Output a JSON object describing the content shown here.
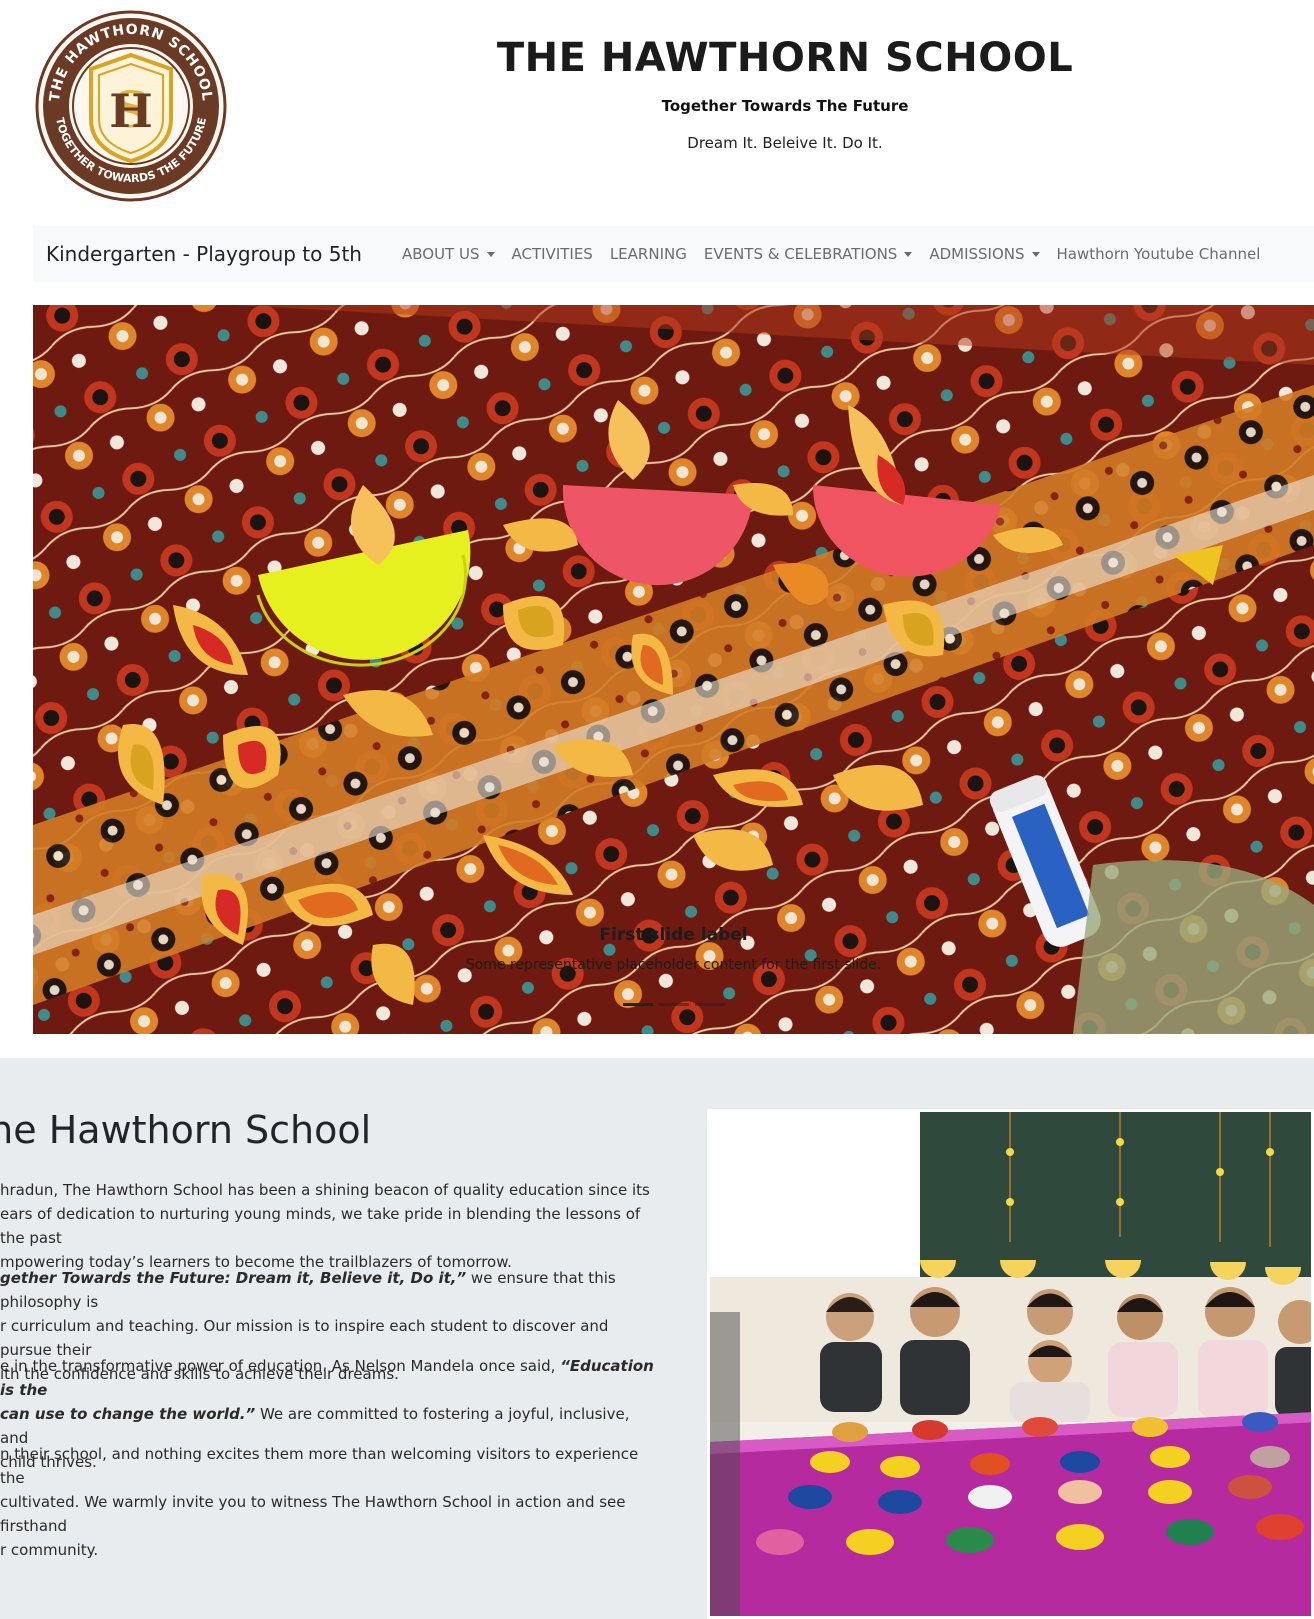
{
  "header": {
    "logo_alt": "The Hawthorn School logo",
    "logo_ring_top": "THE HAWTHORN SCHOOL",
    "logo_ring_bottom": "TOGETHER TOWARDS THE FUTURE",
    "title": "THE HAWTHORN SCHOOL",
    "tagline": "Together Towards The Future",
    "motto": "Dream It. Beleive It. Do It."
  },
  "navbar": {
    "brand": "Kindergarten - Playgroup to 5th",
    "items": [
      {
        "label": "ABOUT US",
        "dropdown": true
      },
      {
        "label": "ACTIVITIES",
        "dropdown": false
      },
      {
        "label": "LEARNING",
        "dropdown": false
      },
      {
        "label": "EVENTS & CELEBRATIONS",
        "dropdown": true
      },
      {
        "label": "ADMISSIONS",
        "dropdown": true
      },
      {
        "label": "Hawthorn Youtube Channel",
        "dropdown": false
      }
    ]
  },
  "carousel": {
    "caption_title": "First slide label",
    "caption_text": "Some representative placeholder content for the first slide.",
    "slide_count": 3,
    "active_index": 0
  },
  "welcome": {
    "heading": "ome to The Hawthorn School",
    "paragraphs": [
      {
        "lines": [
          "hradun, The Hawthorn School has been a shining beacon of quality education since its",
          "ears of dedication to nurturing young minds, we take pride in blending the lessons of the past",
          "mpowering today’s learners to become the trailblazers of tomorrow."
        ]
      },
      {
        "lines_emph": "gether Towards the Future: Dream it, Believe it, Do it,”",
        "lines_rest": " we ensure that this philosophy is",
        "lines": [
          "r curriculum and teaching. Our mission is to inspire each student to discover and pursue their",
          "ith the confidence and skills to achieve their dreams."
        ]
      },
      {
        "line1_plain": "e in the transformative power of education. As Nelson Mandela once said, ",
        "line1_emph": "“Education is the",
        "line2_emph": " can use to change the world.”",
        "line2_plain": " We are committed to fostering a joyful, inclusive, and",
        "line3": " child thrives."
      },
      {
        "lines": [
          "n their school, and nothing excites them more than welcoming visitors to experience the",
          " cultivated. We warmly invite you to witness The Hawthorn School in action and see firsthand",
          "r community."
        ]
      }
    ]
  },
  "colors": {
    "navbar_bg": "#f8f9fa",
    "welcome_bg": "#e9ecef",
    "logo_brown": "#6b3a24",
    "logo_gold": "#d9a520"
  }
}
